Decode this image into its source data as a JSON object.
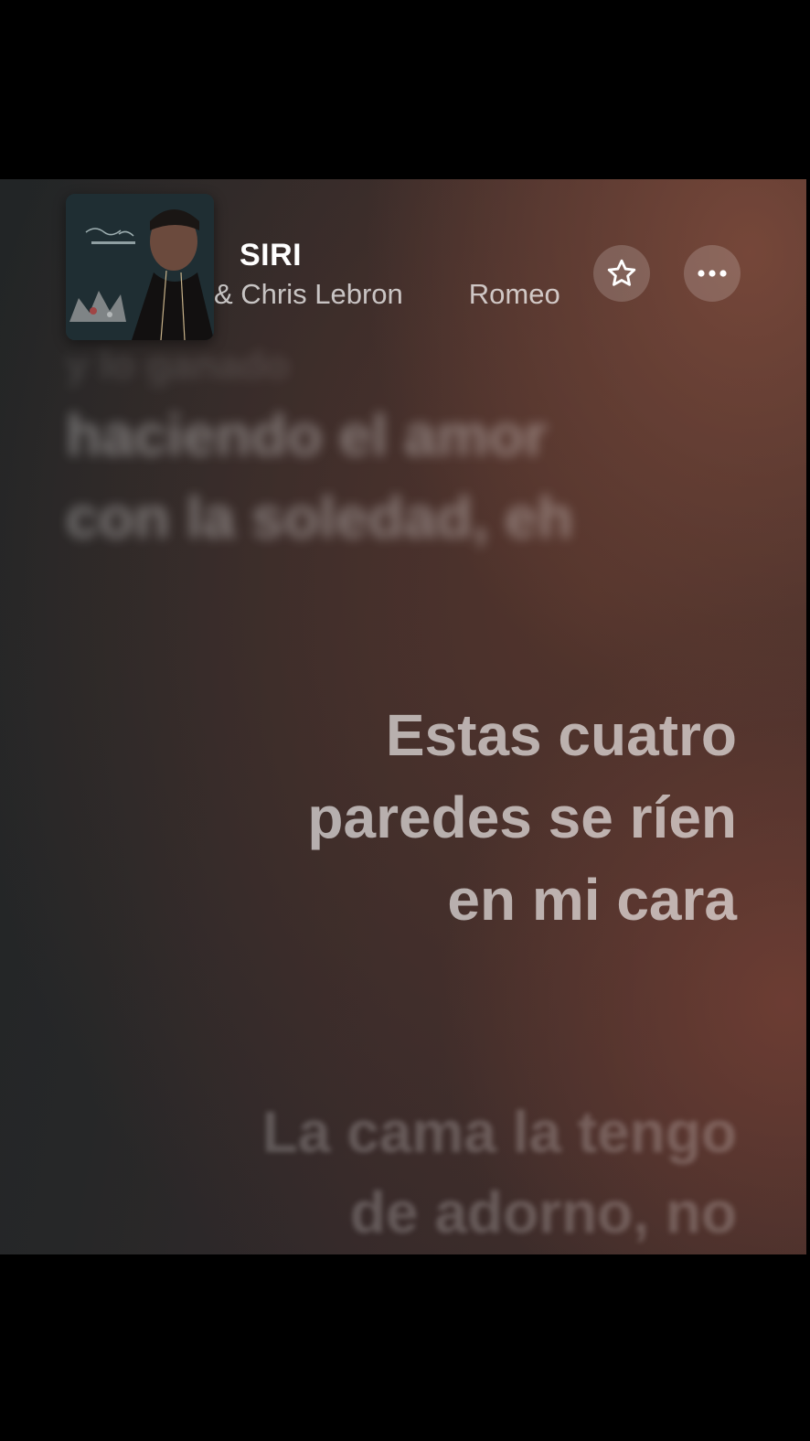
{
  "now_playing": {
    "title": "SIRI",
    "artists": "& Chris Lebron",
    "album_artist": "Romeo",
    "album_art_icon": "album-cover-portrait-crown"
  },
  "controls": {
    "favorite_icon": "star-icon",
    "more_icon": "ellipsis-icon"
  },
  "lyrics": {
    "past_top": "y lo ganado",
    "past": [
      "haciendo el amor",
      "con la soledad, eh"
    ],
    "current": [
      "Estas cuatro",
      "paredes se ríen",
      "en mi cara"
    ],
    "upcoming": [
      "La cama la tengo",
      "de adorno, no"
    ]
  }
}
